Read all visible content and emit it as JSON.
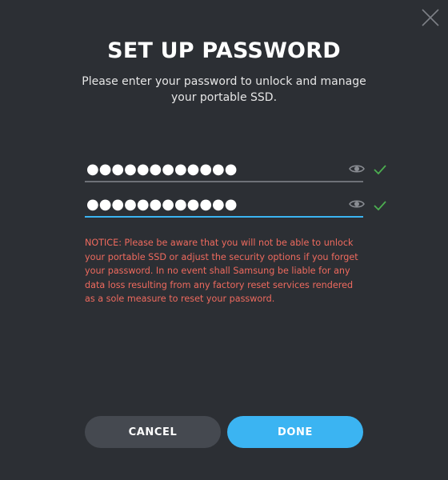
{
  "dialog": {
    "title": "SET UP PASSWORD",
    "subtitle": "Please enter your password to unlock and manage your portable SSD.",
    "close_icon": "close-icon"
  },
  "fields": {
    "password": {
      "value": "●●●●●●●●●●●●",
      "visibility_icon": "eye-icon",
      "status_icon": "check-icon"
    },
    "confirm_password": {
      "value": "●●●●●●●●●●●●",
      "visibility_icon": "eye-icon",
      "status_icon": "check-icon"
    }
  },
  "notice": "NOTICE: Please be aware that you will not be able to unlock your portable SSD or adjust the security options if you forget your password. In no event shall Samsung be liable for any data loss resulting from any factory reset services rendered as a sole measure to reset your password.",
  "buttons": {
    "cancel_label": "CANCEL",
    "done_label": "DONE"
  },
  "colors": {
    "background": "#2c2f34",
    "accent": "#3bb4f2",
    "success": "#4caf50",
    "notice": "#ee6a5e",
    "secondary_button": "#454950"
  }
}
